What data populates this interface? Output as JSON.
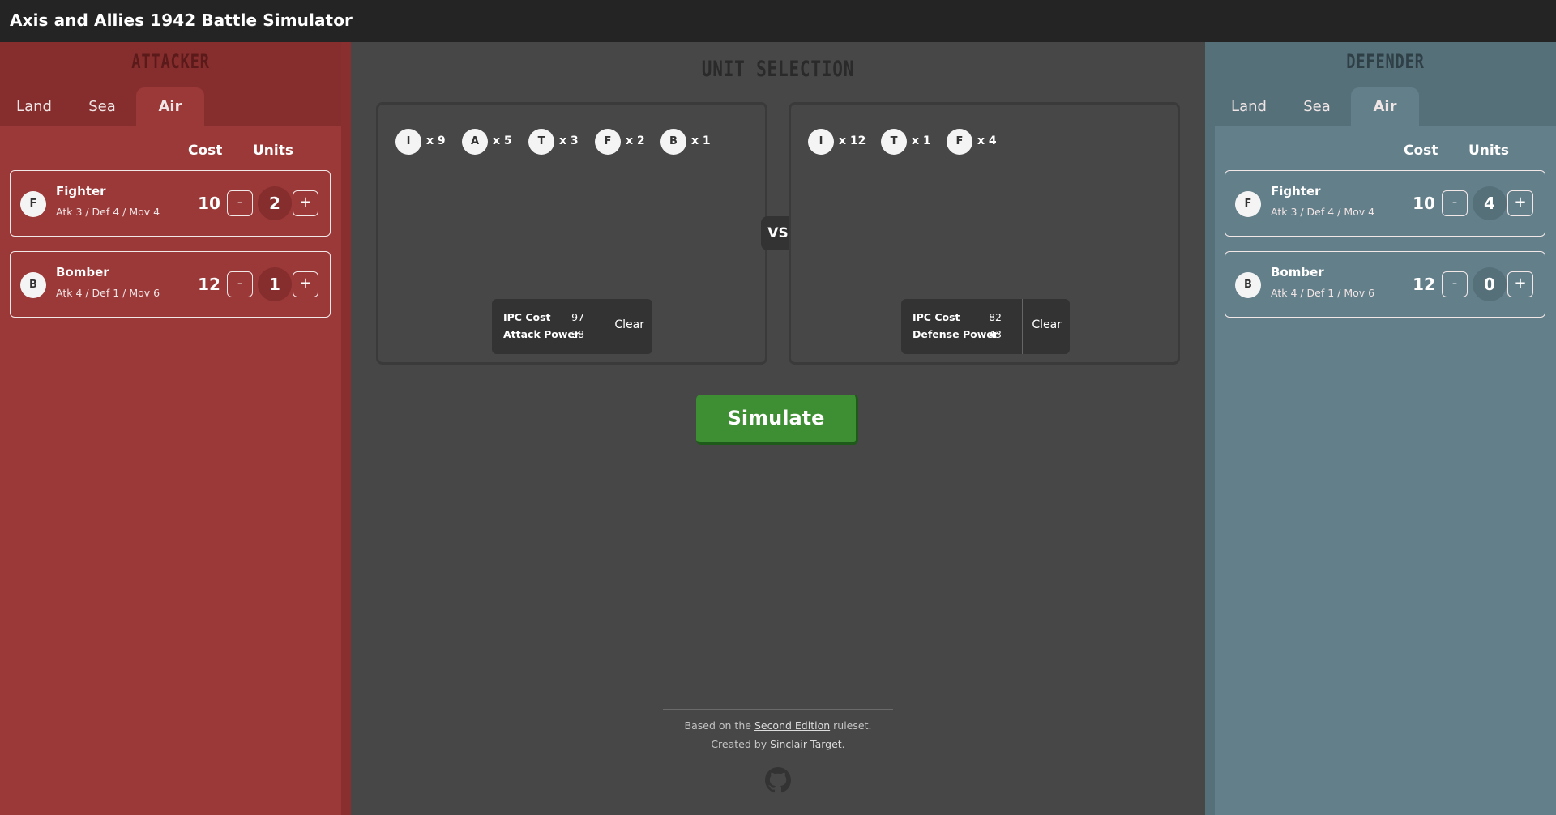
{
  "app": {
    "title": "Axis and Allies 1942 Battle Simulator"
  },
  "tabs": [
    "Land",
    "Sea",
    "Air"
  ],
  "columns": {
    "cost": "Cost",
    "units": "Units"
  },
  "buttons": {
    "minus": "-",
    "plus": "+"
  },
  "attacker": {
    "heading": "ATTACKER",
    "active_tab": "Air",
    "units": [
      {
        "badge": "F",
        "name": "Fighter",
        "stats": "Atk 3 / Def 4 / Mov 4",
        "cost": "10",
        "count": "2"
      },
      {
        "badge": "B",
        "name": "Bomber",
        "stats": "Atk 4 / Def 1 / Mov 6",
        "cost": "12",
        "count": "1"
      }
    ]
  },
  "defender": {
    "heading": "DEFENDER",
    "active_tab": "Air",
    "units": [
      {
        "badge": "F",
        "name": "Fighter",
        "stats": "Atk 3 / Def 4 / Mov 4",
        "cost": "10",
        "count": "4"
      },
      {
        "badge": "B",
        "name": "Bomber",
        "stats": "Atk 4 / Def 1 / Mov 6",
        "cost": "12",
        "count": "0"
      }
    ]
  },
  "selection": {
    "title": "UNIT SELECTION",
    "vs": "VS",
    "attacker": {
      "chips": [
        {
          "letter": "I",
          "qty": "x 9"
        },
        {
          "letter": "A",
          "qty": "x 5"
        },
        {
          "letter": "T",
          "qty": "x 3"
        },
        {
          "letter": "F",
          "qty": "x 2"
        },
        {
          "letter": "B",
          "qty": "x 1"
        }
      ],
      "summary": {
        "cost_label": "IPC Cost",
        "cost_value": "97",
        "power_label": "Attack Power",
        "power_value": "38",
        "clear": "Clear"
      }
    },
    "defender": {
      "chips": [
        {
          "letter": "I",
          "qty": "x 12"
        },
        {
          "letter": "T",
          "qty": "x 1"
        },
        {
          "letter": "F",
          "qty": "x 4"
        }
      ],
      "summary": {
        "cost_label": "IPC Cost",
        "cost_value": "82",
        "power_label": "Defense Power",
        "power_value": "43",
        "clear": "Clear"
      }
    }
  },
  "simulate": "Simulate",
  "footer": {
    "line1_pre": "Based on the ",
    "line1_link": "Second Edition",
    "line1_post": " ruleset.",
    "line2_pre": "Created by ",
    "line2_link": "Sinclair Target",
    "line2_post": ".",
    "icon": "github-icon"
  },
  "colors": {
    "attacker": "#9b3838",
    "defender": "#637f8a",
    "simulate": "#3e8e33",
    "background": "#474747",
    "topbar": "#242424"
  }
}
